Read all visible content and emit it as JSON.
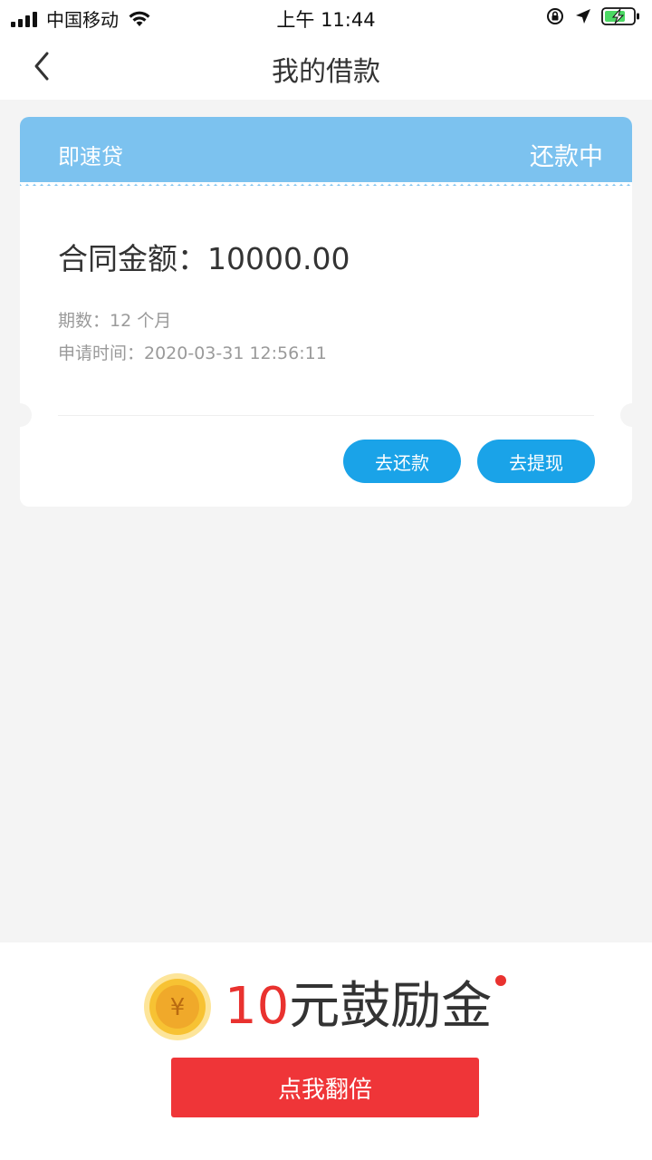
{
  "status_bar": {
    "carrier": "中国移动",
    "time": "上午 11:44"
  },
  "nav": {
    "title": "我的借款"
  },
  "loan_card": {
    "product_name": "即速贷",
    "status": "还款中",
    "contract_amount": "合同金额：10000.00",
    "term": "期数：12 个月",
    "apply_time": "申请时间：2020-03-31 12:56:11",
    "repay_button": "去还款",
    "withdraw_button": "去提现"
  },
  "promo": {
    "coin_symbol": "¥",
    "amount": "10",
    "label": "元鼓励金",
    "button": "点我翻倍"
  },
  "colors": {
    "header_blue": "#7cc2ef",
    "button_blue": "#1aa3e8",
    "promo_red": "#ef3538"
  }
}
